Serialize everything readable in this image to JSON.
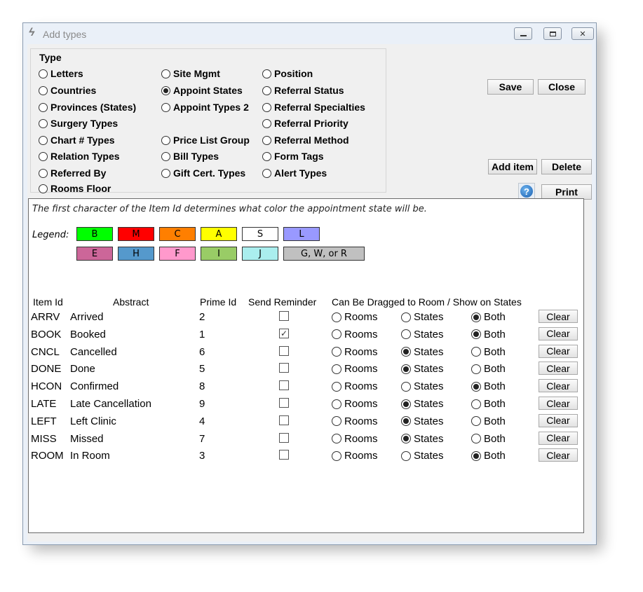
{
  "window": {
    "title": "Add types"
  },
  "type_group": {
    "label": "Type",
    "selected": "Appoint States",
    "options": [
      "Letters",
      "Countries",
      "Provinces (States)",
      "Surgery Types",
      "Chart # Types",
      "Relation Types",
      "Referred By",
      "Rooms Floor",
      "Site Mgmt",
      "Appoint States",
      "Appoint Types 2",
      "Price List Group",
      "Bill Types",
      "Gift Cert. Types",
      "Position",
      "Referral Status",
      "Referral Specialties",
      "Referral Priority",
      "Referral Method",
      "Form Tags",
      "Alert Types"
    ]
  },
  "buttons": {
    "save": "Save",
    "close": "Close",
    "add_item": "Add item",
    "delete": "Delete",
    "help": "?",
    "print": "Print"
  },
  "info_text": "The first character of the Item Id determines what color the appointment state will be.",
  "legend": {
    "label": "Legend:",
    "items": [
      {
        "label": "B",
        "color": "#00ff00"
      },
      {
        "label": "M",
        "color": "#ff0000"
      },
      {
        "label": "C",
        "color": "#ff7f00"
      },
      {
        "label": "A",
        "color": "#ffff00"
      },
      {
        "label": "S",
        "color": "#ffffff"
      },
      {
        "label": "L",
        "color": "#9999ff"
      },
      {
        "label": "E",
        "color": "#cc6699"
      },
      {
        "label": "H",
        "color": "#5599cc"
      },
      {
        "label": "F",
        "color": "#ff99cc"
      },
      {
        "label": "I",
        "color": "#99cc66"
      },
      {
        "label": "J",
        "color": "#aaeeee"
      },
      {
        "label": "G, W, or R",
        "color": "#c0c0c0"
      }
    ]
  },
  "table": {
    "headers": {
      "item_id": "Item Id",
      "abstract": "Abstract",
      "prime_id": "Prime Id",
      "send_reminder": "Send Reminder",
      "drag": "Can Be Dragged to Room / Show on States"
    },
    "option_labels": {
      "rooms": "Rooms",
      "states": "States",
      "both": "Both"
    },
    "clear_label": "Clear",
    "rows": [
      {
        "id": "ARRV",
        "abstract": "Arrived",
        "prime": "2",
        "reminder": false,
        "drag": "both"
      },
      {
        "id": "BOOK",
        "abstract": "Booked",
        "prime": "1",
        "reminder": true,
        "drag": "both"
      },
      {
        "id": "CNCL",
        "abstract": "Cancelled",
        "prime": "6",
        "reminder": false,
        "drag": "states"
      },
      {
        "id": "DONE",
        "abstract": "Done",
        "prime": "5",
        "reminder": false,
        "drag": "states"
      },
      {
        "id": "HCON",
        "abstract": "Confirmed",
        "prime": "8",
        "reminder": false,
        "drag": "both"
      },
      {
        "id": "LATE",
        "abstract": "Late Cancellation",
        "prime": "9",
        "reminder": false,
        "drag": "states"
      },
      {
        "id": "LEFT",
        "abstract": "Left Clinic",
        "prime": "4",
        "reminder": false,
        "drag": "states"
      },
      {
        "id": "MISS",
        "abstract": "Missed",
        "prime": "7",
        "reminder": false,
        "drag": "states"
      },
      {
        "id": "ROOM",
        "abstract": "In Room",
        "prime": "3",
        "reminder": false,
        "drag": "both"
      }
    ]
  }
}
